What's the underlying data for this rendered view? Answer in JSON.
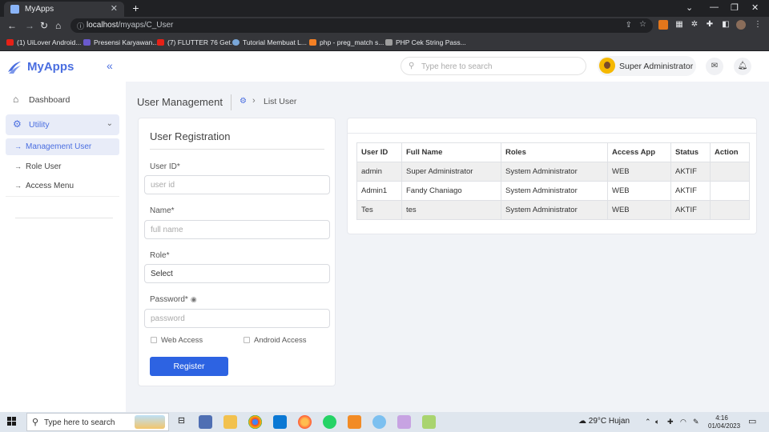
{
  "browser": {
    "tab_title": "MyApps",
    "url_host": "localhost",
    "url_path": "/myaps/C_User",
    "bookmarks": [
      {
        "label": "(1) UiLover Android...",
        "color": "#e62117"
      },
      {
        "label": "Presensi Karyawan...",
        "color": "#6a5acd"
      },
      {
        "label": "(7) FLUTTER 76 Get...",
        "color": "#e62117"
      },
      {
        "label": "Tutorial Membuat L...",
        "color": "#7aa7d9"
      },
      {
        "label": "php - preg_match s...",
        "color": "#f48024"
      },
      {
        "label": "PHP Cek String Pass...",
        "color": "#9e9e9e"
      }
    ]
  },
  "app": {
    "name": "MyApps",
    "search_placeholder": "Type here to search",
    "user_name": "Super Administrator"
  },
  "sidebar": {
    "dashboard": "Dashboard",
    "utility": "Utility",
    "sub_items": [
      "Management User",
      "Role User",
      "Access Menu"
    ]
  },
  "page": {
    "title": "User Management",
    "breadcrumb_current": "List User"
  },
  "form": {
    "title": "User Registration",
    "userid_label": "User ID*",
    "userid_placeholder": "user id",
    "name_label": "Name*",
    "name_placeholder": "full name",
    "role_label": "Role*",
    "role_value": "Select",
    "password_label": "Password*",
    "password_placeholder": "password",
    "web_access": "Web Access",
    "android_access": "Android Access",
    "submit": "Register"
  },
  "table": {
    "headers": [
      "User ID",
      "Full Name",
      "Roles",
      "Access App",
      "Status",
      "Action"
    ],
    "rows": [
      [
        "admin",
        "Super Administrator",
        "System Administrator",
        "WEB",
        "AKTIF",
        ""
      ],
      [
        "Admin1",
        "Fandy Chaniago",
        "System Administrator",
        "WEB",
        "AKTIF",
        ""
      ],
      [
        "Tes",
        "tes",
        "System Administrator",
        "WEB",
        "AKTIF",
        ""
      ]
    ]
  },
  "taskbar": {
    "search_placeholder": "Type here to search",
    "weather": "29°C  Hujan",
    "time": "4:16",
    "date": "01/04/2023"
  },
  "colors": {
    "accent": "#4a6ee0",
    "button": "#2d63e2"
  }
}
